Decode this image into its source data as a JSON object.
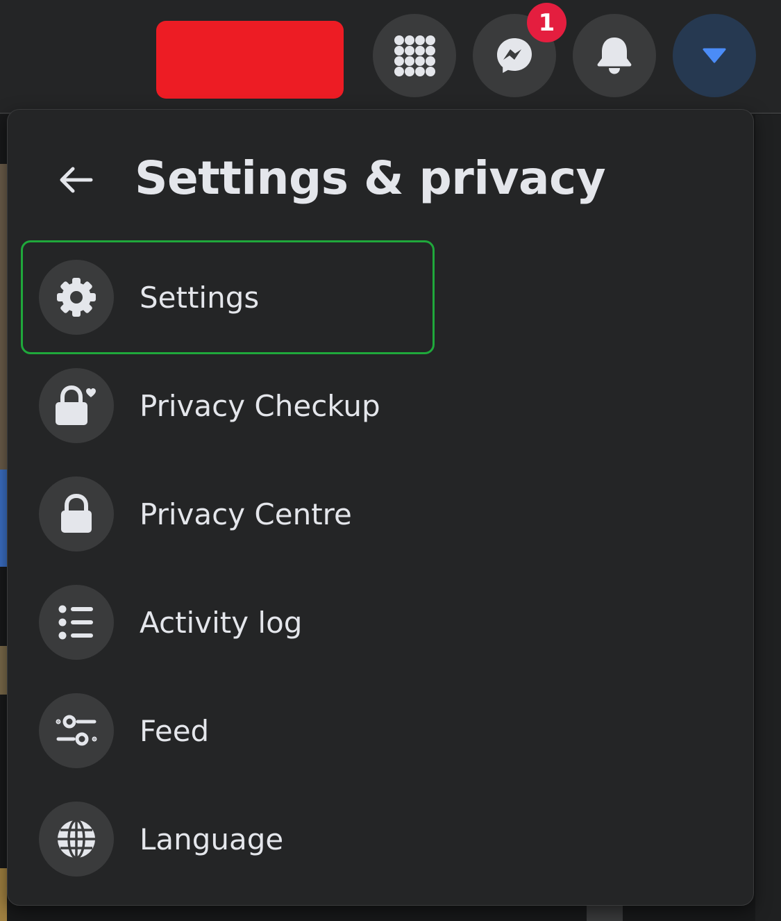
{
  "topbar": {
    "buttons": [
      {
        "name": "menu-grid",
        "icon": "grid-icon"
      },
      {
        "name": "messenger",
        "icon": "messenger-icon",
        "badge": "1"
      },
      {
        "name": "notifications",
        "icon": "bell-icon"
      },
      {
        "name": "account",
        "icon": "caret-down-icon"
      }
    ],
    "messenger_badge": "1"
  },
  "panel": {
    "title": "Settings & privacy",
    "items": [
      {
        "label": "Settings",
        "icon": "gear-icon"
      },
      {
        "label": "Privacy Checkup",
        "icon": "lock-heart-icon"
      },
      {
        "label": "Privacy Centre",
        "icon": "lock-icon"
      },
      {
        "label": "Activity log",
        "icon": "list-icon"
      },
      {
        "label": "Feed",
        "icon": "sliders-icon"
      },
      {
        "label": "Language",
        "icon": "globe-icon"
      }
    ]
  },
  "colors": {
    "background": "#18191a",
    "surface": "#242526",
    "icon_circle": "#3a3b3c",
    "text": "#e4e6eb",
    "badge": "#e41e3f",
    "accent_blue": "#2d88ff",
    "highlight_green": "#1fa83b",
    "redaction": "#ed1c24"
  }
}
